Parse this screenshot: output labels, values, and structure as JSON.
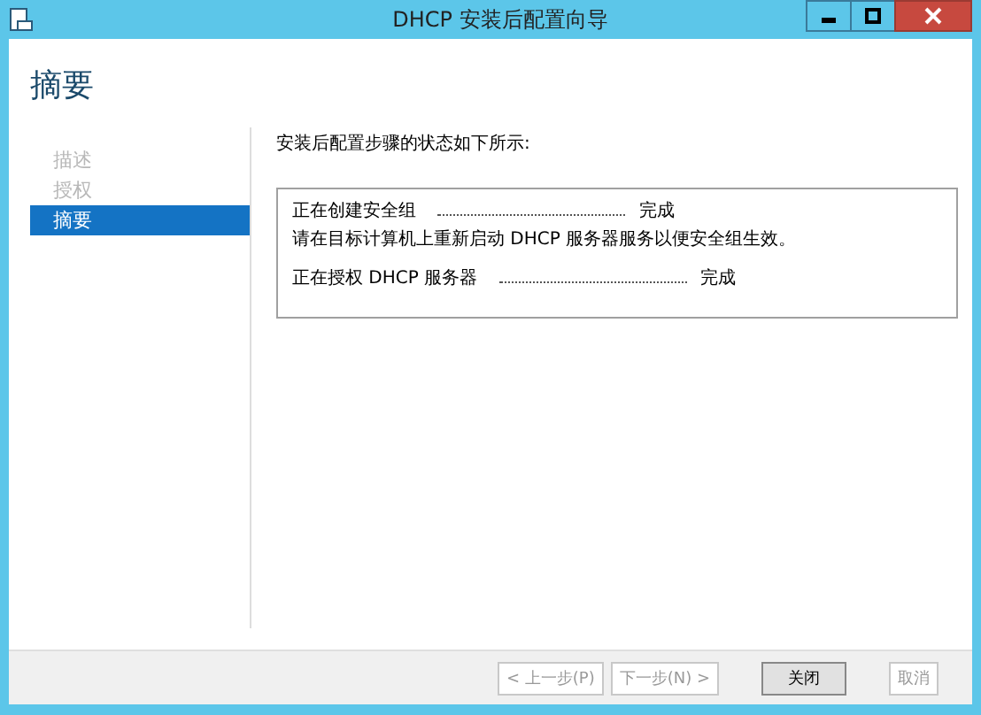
{
  "window": {
    "title": "DHCP 安装后配置向导"
  },
  "page_title": "摘要",
  "nav": [
    {
      "label": "描述",
      "selected": false,
      "disabled": true
    },
    {
      "label": "授权",
      "selected": false,
      "disabled": true
    },
    {
      "label": "摘要",
      "selected": true,
      "disabled": false
    }
  ],
  "intro": "安装后配置步骤的状态如下所示:",
  "steps": [
    {
      "label": "正在创建安全组",
      "status": "完成",
      "note": "请在目标计算机上重新启动 DHCP 服务器服务以便安全组生效。"
    },
    {
      "label": "正在授权 DHCP 服务器",
      "status": "完成"
    }
  ],
  "buttons": [
    {
      "label": "< 上一步(P)",
      "disabled": true,
      "default": false
    },
    {
      "label": "下一步(N) >",
      "disabled": true,
      "default": false
    },
    {
      "label": "关闭",
      "disabled": false,
      "default": true
    },
    {
      "label": "取消",
      "disabled": true,
      "default": false
    }
  ]
}
